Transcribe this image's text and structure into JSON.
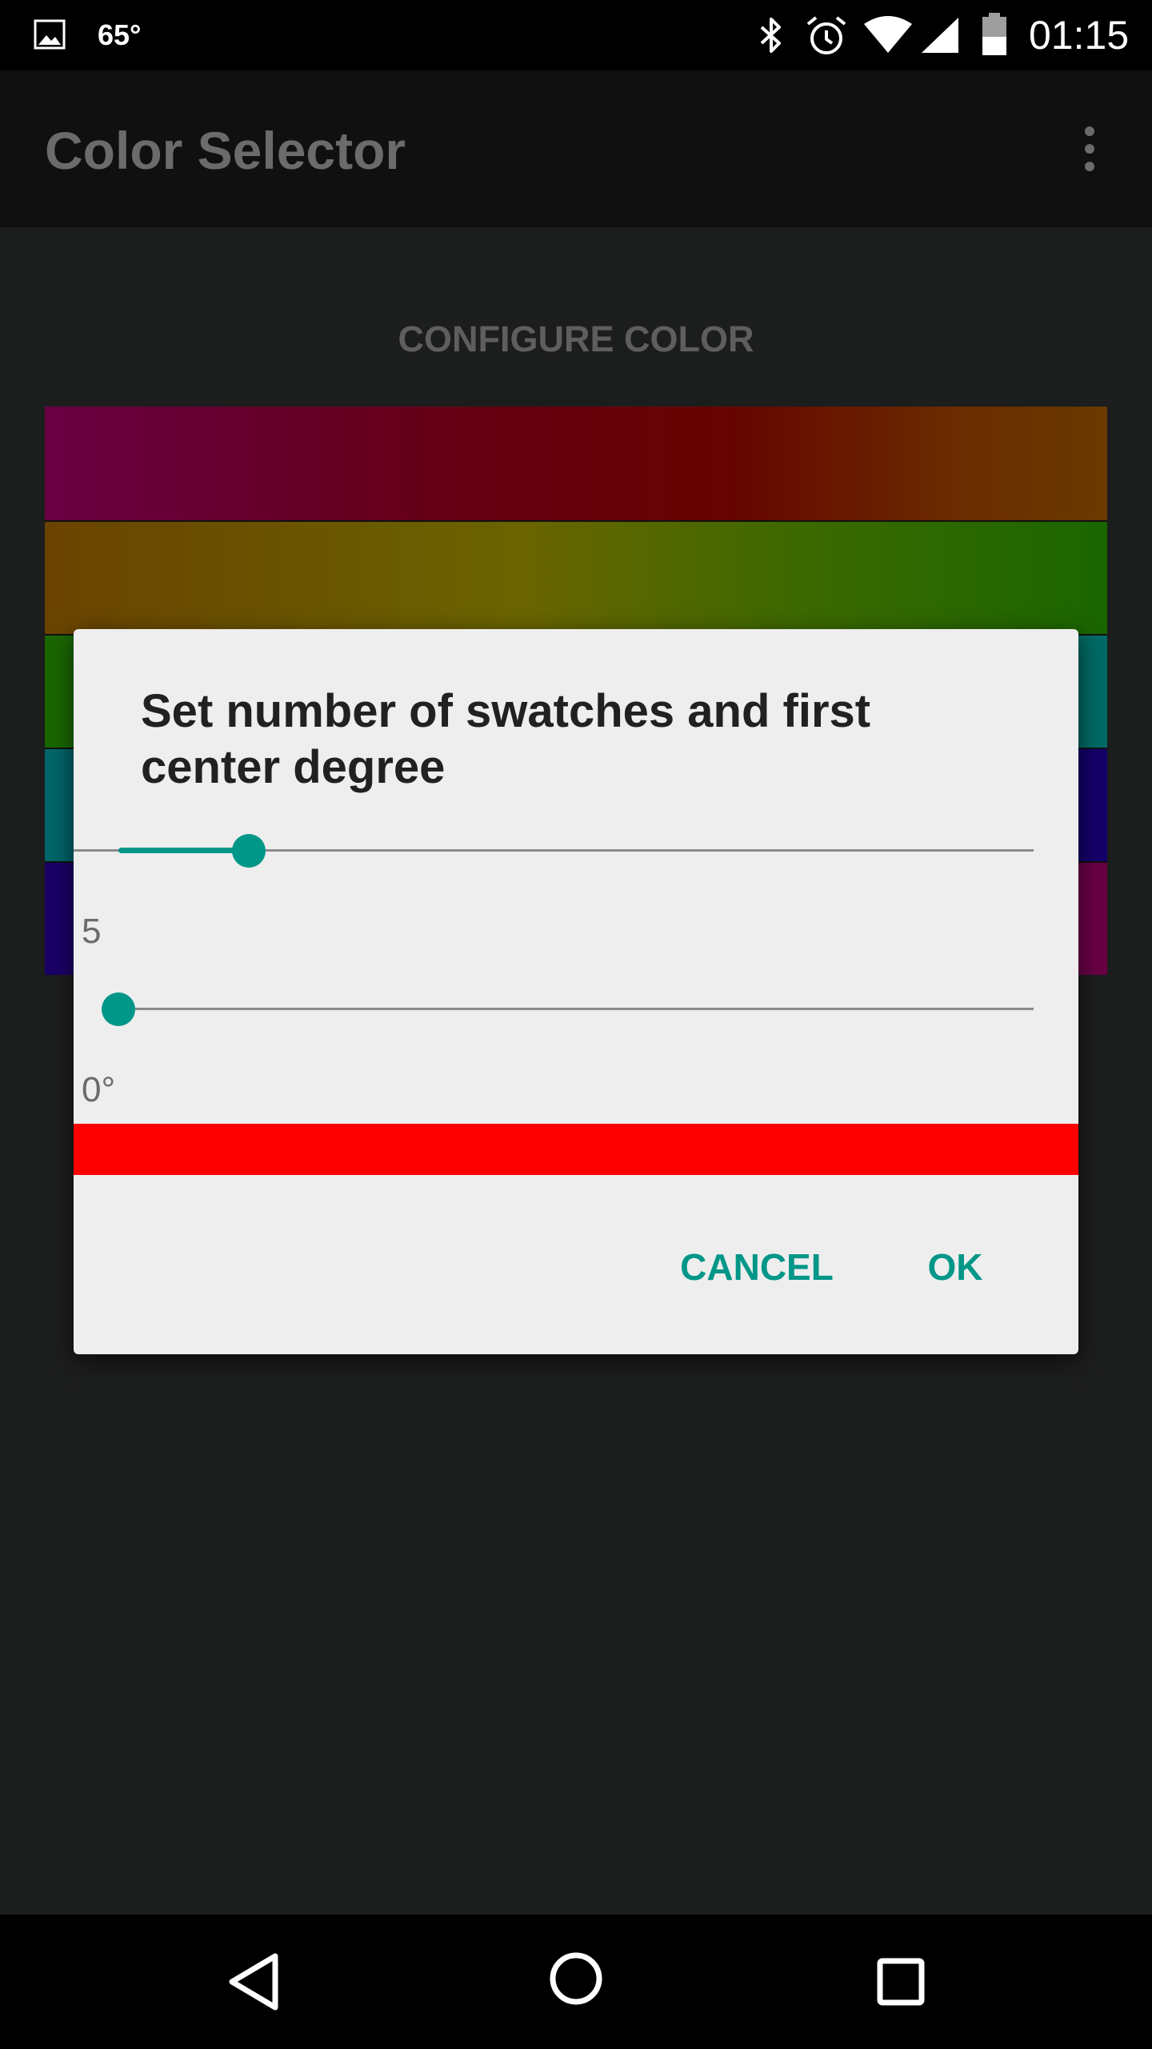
{
  "status_bar": {
    "temperature": "65°",
    "time": "01:15",
    "icons": [
      "gallery-icon",
      "bluetooth-icon",
      "alarm-icon",
      "wifi-icon",
      "signal-icon",
      "battery-icon"
    ]
  },
  "app_bar": {
    "title": "Color Selector",
    "menu_icon": "overflow-menu-icon"
  },
  "main": {
    "configure_label": "CONFIGURE COLOR",
    "swatch_count_visible": 5
  },
  "dialog": {
    "title": "Set number of swatches and first center degree",
    "swatch_slider": {
      "value_label": "5"
    },
    "degree_slider": {
      "value_label": "0°"
    },
    "preview_color": "#ff0000",
    "cancel_label": "CANCEL",
    "ok_label": "OK"
  },
  "colors": {
    "accent": "#009688",
    "dialog_background": "#eeeeee",
    "app_background": "#1c1d1d"
  },
  "nav_bar": {
    "icons": [
      "back-icon",
      "home-icon",
      "recents-icon"
    ]
  }
}
